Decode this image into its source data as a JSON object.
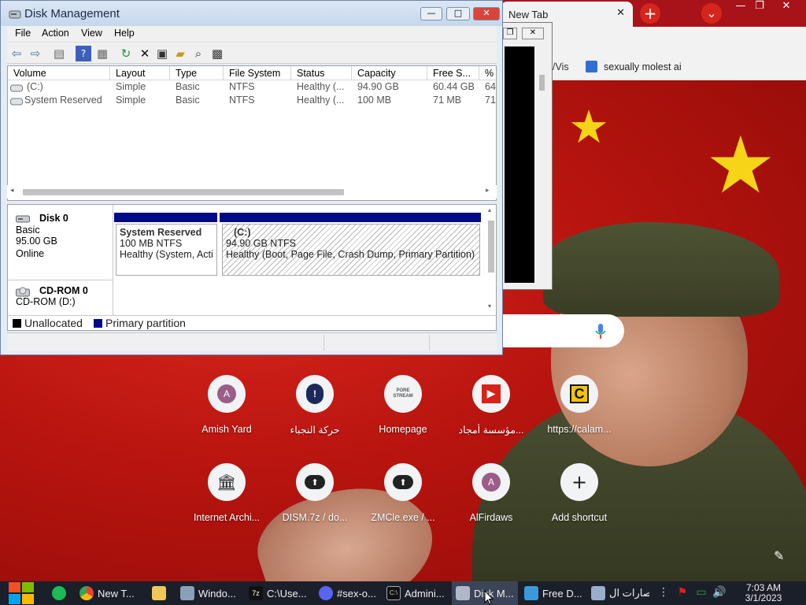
{
  "chrome": {
    "tab_partial_label": "New Tab",
    "tab_close_glyph": "✕",
    "new_tab_glyph": "+",
    "profile_glyph": "⌄",
    "window_controls": [
      "—",
      "❐",
      "✕"
    ],
    "bookmark_partial": "/Vis",
    "bookmark_item": "sexually molest ai",
    "toolbar_icons": [
      "share-icon",
      "star-icon",
      "ublock-icon",
      "profile-avatar-icon",
      "pride-icon",
      "extensions-icon",
      "sidepanel-icon",
      "account-icon",
      "menu-icon"
    ],
    "shortcuts": [
      {
        "label": "Amish Yard",
        "icon": "letter-a-icon",
        "glyph": "A"
      },
      {
        "label": "حركة النجباء",
        "icon": "alert-logo-icon",
        "glyph": "!"
      },
      {
        "label": "Homepage",
        "icon": "porestream-logo-icon",
        "glyph": "PORE STREAM"
      },
      {
        "label": "مؤسسة أمجاد...",
        "icon": "play-logo-icon",
        "glyph": "▶"
      },
      {
        "label": "https://calam...",
        "icon": "c-logo-icon",
        "glyph": "C"
      },
      {
        "label": "Internet Archi...",
        "icon": "archive-icon",
        "glyph": "🏛"
      },
      {
        "label": "DISM.7z / do...",
        "icon": "cloud-upload-icon",
        "glyph": "⬆"
      },
      {
        "label": "ZMCle.exe / ...",
        "icon": "cloud-upload-icon",
        "glyph": "⬆"
      },
      {
        "label": "AlFirdaws",
        "icon": "letter-a-icon",
        "glyph": "A"
      },
      {
        "label": "Add shortcut",
        "icon": "plus-icon",
        "glyph": "+"
      }
    ],
    "customize_glyph": "✎"
  },
  "disk_management": {
    "title": "Disk Management",
    "menu": [
      "File",
      "Action",
      "View",
      "Help"
    ],
    "columns": [
      "Volume",
      "Layout",
      "Type",
      "File System",
      "Status",
      "Capacity",
      "Free S...",
      "%"
    ],
    "rows": [
      [
        "(C:)",
        "Simple",
        "Basic",
        "NTFS",
        "Healthy (...",
        "94.90 GB",
        "60.44 GB",
        "64"
      ],
      [
        "System Reserved",
        "Simple",
        "Basic",
        "NTFS",
        "Healthy (...",
        "100 MB",
        "71 MB",
        "71"
      ]
    ],
    "disks": [
      {
        "name": "Disk 0",
        "type": "Basic",
        "size": "95.00 GB",
        "state": "Online"
      },
      {
        "name": "CD-ROM 0",
        "type": "CD-ROM (D:)"
      }
    ],
    "partitions": [
      {
        "name": "System Reserved",
        "size": "100 MB NTFS",
        "status": "Healthy (System, Acti"
      },
      {
        "name": "(C:)",
        "size": "94.90 GB NTFS",
        "status": "Healthy (Boot, Page File, Crash Dump, Primary Partition)"
      }
    ],
    "legend": [
      {
        "label": "Unallocated",
        "color": "#000000"
      },
      {
        "label": "Primary partition",
        "color": "#000a86"
      }
    ],
    "controls": [
      "—",
      "□",
      "✕"
    ]
  },
  "taskbar": {
    "items": [
      {
        "label": "",
        "icon": "spotify-icon",
        "color": "#1db954"
      },
      {
        "label": "New T...",
        "icon": "chrome-icon",
        "color": "#e0c030"
      },
      {
        "label": "",
        "icon": "folder-icon",
        "color": "#f0c85a"
      },
      {
        "label": "Windo...",
        "icon": "window-app-icon",
        "color": "#8aa0b8"
      },
      {
        "label": "C:\\Use...",
        "icon": "7zip-icon",
        "color": "#dddddd"
      },
      {
        "label": "#sex-o...",
        "icon": "discord-icon",
        "color": "#5865f2"
      },
      {
        "label": "Admini...",
        "icon": "cmd-icon",
        "color": "#cccccc"
      },
      {
        "label": "Disk M...",
        "icon": "disk-mgmt-icon",
        "color": "#b0b8c8"
      },
      {
        "label": "Free D...",
        "icon": "free-download-icon",
        "color": "#3a9ad9"
      },
      {
        "label": "صارات ال...",
        "icon": "picture-icon",
        "color": "#9aaecc"
      }
    ],
    "time": "7:03 AM",
    "date": "3/1/2023"
  }
}
